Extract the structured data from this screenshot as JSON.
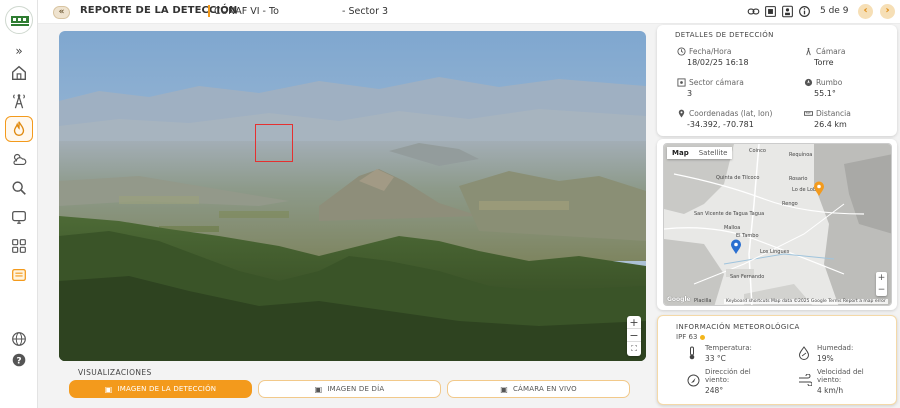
{
  "header": {
    "title": "REPORTE DE LA DETECCIÓN",
    "tower_prefix": "CONAF VI - Torre",
    "sector": "- Sector 3",
    "page_count": "5 de 9"
  },
  "visualizations": {
    "label": "VISUALIZACIONES",
    "buttons": [
      {
        "label": "IMAGEN DE LA DETECCIÓN"
      },
      {
        "label": "IMAGEN DE DÍA"
      },
      {
        "label": "CÁMARA EN VIVO"
      }
    ]
  },
  "details": {
    "title": "DETALLES DE DETECCIÓN",
    "fecha_label": "Fecha/Hora",
    "fecha_value": "18/02/25 16:18",
    "camara_label": "Cámara",
    "camara_value": "Torre",
    "sector_label": "Sector cámara",
    "sector_value": "3",
    "rumbo_label": "Rumbo",
    "rumbo_value": "55.1°",
    "coord_label": "Coordenadas (lat, lon)",
    "coord_value": "-34.392, -70.781",
    "dist_label": "Distancia",
    "dist_value": "26.4 km"
  },
  "map": {
    "tabs": [
      "Map",
      "Satellite"
    ],
    "places": [
      "Coinco",
      "Requínoa",
      "Quinta de Tilcoco",
      "Rosario",
      "Lo de Lobo",
      "Rengo",
      "San Vicente de Tagua Tagua",
      "Malloa",
      "El Tambo",
      "Los Lingues",
      "San Fernando",
      "Placilla"
    ],
    "footer": "Keyboard shortcuts   Map data ©2025 Google   Terms   Report a map error",
    "google": "Google"
  },
  "meteo": {
    "title": "INFORMACIÓN METEOROLÓGICA",
    "ipf": "IPF 63",
    "temp_label": "Temperatura:",
    "temp_value": "33 °C",
    "hum_label": "Humedad:",
    "hum_value": "19%",
    "dir_label_1": "Dirección del",
    "dir_label_2": "viento:",
    "dir_value": "248°",
    "vel_label_1": "Velocidad del",
    "vel_label_2": "viento:",
    "vel_value": "4 km/h"
  },
  "colors": {
    "accent": "#f39a1c",
    "detection_box": "#e53030"
  }
}
